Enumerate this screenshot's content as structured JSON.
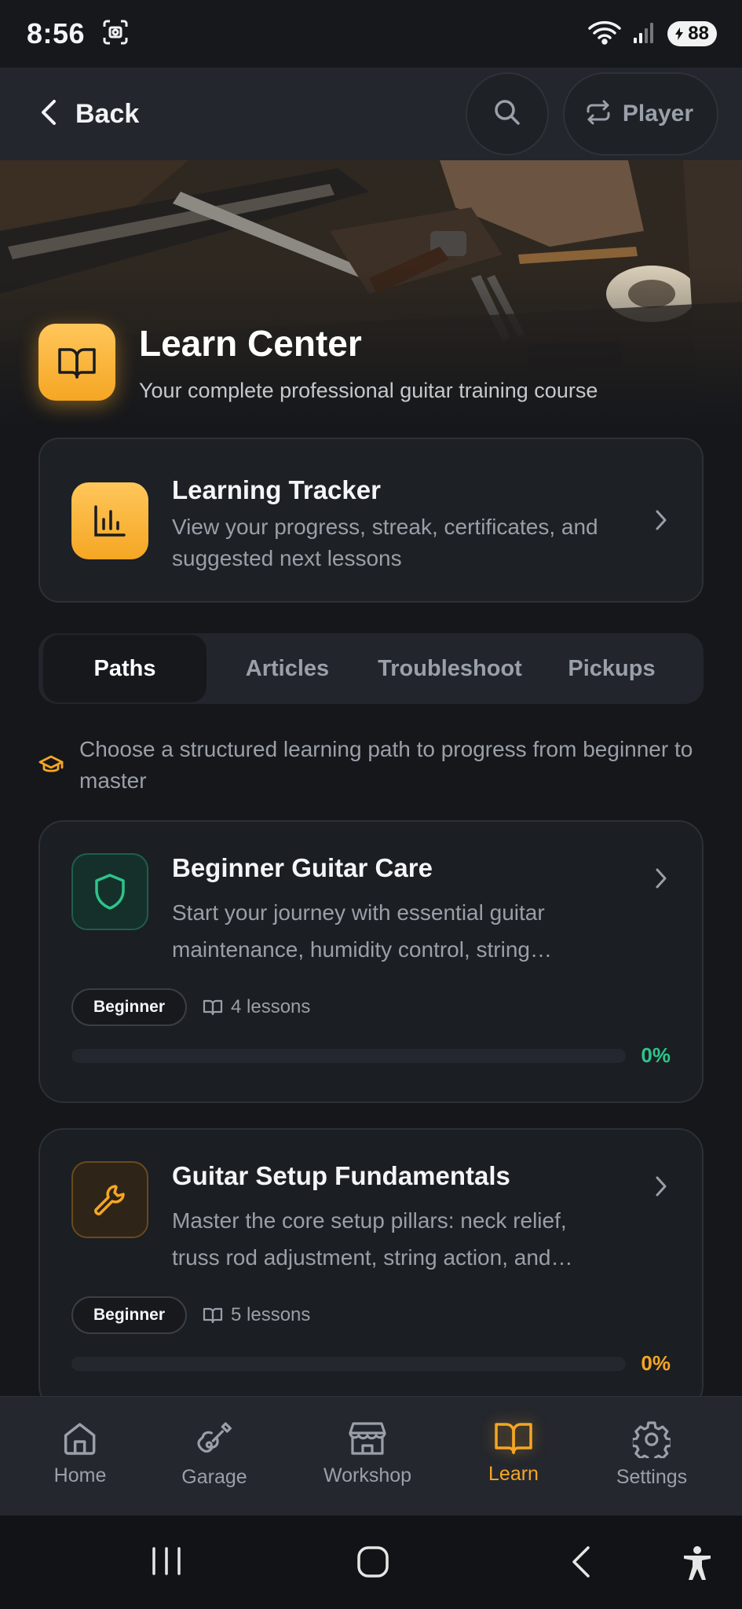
{
  "status_bar": {
    "time": "8:56",
    "battery": "88"
  },
  "app_bar": {
    "back_label": "Back",
    "player_label": "Player"
  },
  "hero": {
    "title": "Learn Center",
    "subtitle": "Your complete professional guitar training course"
  },
  "tracker": {
    "title": "Learning Tracker",
    "description": "View your progress, streak, certificates, and suggested next lessons"
  },
  "tabs": [
    {
      "label": "Paths",
      "active": true
    },
    {
      "label": "Articles",
      "active": false
    },
    {
      "label": "Troubleshoot",
      "active": false
    },
    {
      "label": "Pickups",
      "active": false
    }
  ],
  "hint": "Choose a structured learning path to progress from beginner to master",
  "paths": [
    {
      "title": "Beginner Guitar Care",
      "description": "Start your journey with essential guitar maintenance, humidity control, string…",
      "level": "Beginner",
      "lessons": "4 lessons",
      "progress_label": "0%",
      "progress": 0,
      "accent": "#2ec48a",
      "icon": "shield-icon"
    },
    {
      "title": "Guitar Setup Fundamentals",
      "description": "Master the core setup pillars: neck relief, truss rod adjustment, string action, and…",
      "level": "Beginner",
      "lessons": "5 lessons",
      "progress_label": "0%",
      "progress": 0,
      "accent": "#f5a623",
      "icon": "wrench-icon"
    }
  ],
  "bottom_nav": [
    {
      "label": "Home",
      "icon": "home-icon",
      "active": false
    },
    {
      "label": "Garage",
      "icon": "guitar-icon",
      "active": false
    },
    {
      "label": "Workshop",
      "icon": "store-icon",
      "active": false
    },
    {
      "label": "Learn",
      "icon": "book-open-icon",
      "active": true
    },
    {
      "label": "Settings",
      "icon": "gear-icon",
      "active": false
    }
  ],
  "colors": {
    "accent": "#f5a623",
    "success": "#2ec48a",
    "background": "#15171b",
    "card": "#1b1e23"
  }
}
